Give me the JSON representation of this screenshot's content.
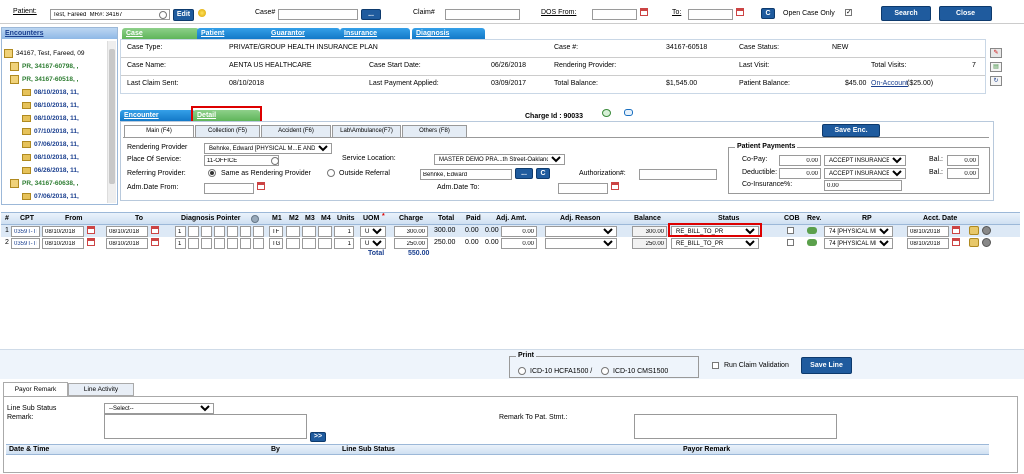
{
  "topbar": {
    "patient_label": "Patient:",
    "patient_value": "Test, Fareed  MR#: 34167",
    "edit": "Edit",
    "case_label": "Case#",
    "ellipsis": "...",
    "claim_label": "Claim#",
    "dos_from_label": "DOS From:",
    "to_label": "To:",
    "c": "C",
    "open_case_only": "Open Case Only",
    "search": "Search",
    "close": "Close"
  },
  "sidebar": {
    "title": "Encounters",
    "items": [
      {
        "label": "34167, Test, Fareed, 09",
        "style": "plain"
      },
      {
        "label": "PR, 34167-60798, ,",
        "style": "green"
      },
      {
        "label": "PR, 34167-60518, ,",
        "style": "green"
      },
      {
        "label": "08/10/2018, 11,",
        "style": "enc"
      },
      {
        "label": "08/10/2018, 11,",
        "style": "enc"
      },
      {
        "label": "08/10/2018, 11,",
        "style": "enc"
      },
      {
        "label": "07/10/2018, 11,",
        "style": "enc"
      },
      {
        "label": "07/06/2018, 11,",
        "style": "enc"
      },
      {
        "label": "08/10/2018, 11,",
        "style": "enc"
      },
      {
        "label": "06/26/2018, 11,",
        "style": "enc"
      },
      {
        "label": "PR, 34167-60638, ,",
        "style": "green"
      },
      {
        "label": "07/06/2018, 11,",
        "style": "enc"
      }
    ]
  },
  "casetabs": {
    "case": "Case",
    "patient": "Patient",
    "guarantor": "Guarantor",
    "insurance": "Insurance",
    "diagnosis": "Diagnosis"
  },
  "caseinfo": {
    "case_type_label": "Case Type:",
    "case_type": "PRIVATE/GROUP HEALTH INSURANCE PLAN",
    "case_no_label": "Case #:",
    "case_no": "34167-60518",
    "case_status_label": "Case Status:",
    "case_status": "NEW",
    "case_name_label": "Case Name:",
    "case_name": "AENTA US HEALTHCARE",
    "start_label": "Case Start Date:",
    "start": "06/26/2018",
    "rendering_label": "Rendering Provider:",
    "last_visit_label": "Last Visit:",
    "total_visits_label": "Total Visits:",
    "total_visits": "7",
    "last_claim_label": "Last Claim Sent:",
    "last_claim": "08/10/2018",
    "last_pay_label": "Last Payment Applied:",
    "last_pay": "03/09/2017",
    "total_bal_label": "Total Balance:",
    "total_bal": "$1,545.00",
    "pat_bal_label": "Patient Balance:",
    "pat_bal": "$45.00",
    "on_account": "On-Account",
    "on_account_amt": "($25.00)"
  },
  "enc": {
    "encounter_tab": "Encounter",
    "detail_tab": "Detail",
    "charge_id": "Charge Id : 90033",
    "subtabs": [
      "Main (F4)",
      "Collection (F5)",
      "Accident (F6)",
      "Lab\\Ambulance(F7)",
      "Others (F8)"
    ],
    "save_enc": "Save Enc.",
    "rendering_label": "Rendering Provider",
    "rendering_val": "Behnke, Edward [PHYSICAL M...E AND REHABILI",
    "pos_label": "Place Of Service:",
    "pos_val": "11-OFFICE",
    "service_loc_label": "Service Location:",
    "service_loc_val": "MASTER DEMO PRA...th Street-Oakland",
    "ref_label": "Referring Provider:",
    "same_as": "Same as Rendering Provider",
    "outside": "Outside Referral",
    "ref_val": "Behnke, Edward",
    "auth_label": "Authorization#:",
    "adm_from_label": "Adm.Date From:",
    "adm_to_label": "Adm.Date To:",
    "payments_title": "Patient Payments",
    "copay_label": "Co-Pay:",
    "copay": "0.00",
    "copay_sel": "ACCEPT INSURANCE",
    "ded_label": "Deductible:",
    "ded": "0.00",
    "ded_sel": "ACCEPT INSURANCE",
    "bal_label": "Bal.:",
    "bal1": "0.00",
    "bal2": "0.00",
    "coins_label": "Co-Insurance%:",
    "coins": "0.00"
  },
  "grid": {
    "headers": [
      "#",
      "CPT",
      "From",
      "To",
      "Diagnosis Pointer",
      "M1",
      "M2",
      "M3",
      "M4",
      "Units",
      "UOM",
      "Charge",
      "Total",
      "Paid",
      "Adj. Amt.",
      "Adj. Reason",
      "Balance",
      "Status",
      "COB",
      "Rev.",
      "RP",
      "Acct. Date"
    ],
    "rows": [
      {
        "n": "1",
        "cpt": "0359T-TI",
        "from": "08/10/2018",
        "to": "08/10/2018",
        "dx": "1",
        "m1": "TF",
        "units": "1",
        "uom": "UN",
        "charge": "300.00",
        "total": "300.00",
        "paid": "0.00",
        "adj": "0.00",
        "adjamt": "0.00",
        "bal": "300.00",
        "status": "RE_BILL_TO_PR",
        "rp": "74 [PHYSICAL MEC",
        "acct": "08/10/2018"
      },
      {
        "n": "2",
        "cpt": "0359T-TI",
        "from": "08/10/2018",
        "to": "08/10/2018",
        "dx": "1",
        "m1": "TG",
        "units": "1",
        "uom": "UN",
        "charge": "250.00",
        "total": "250.00",
        "paid": "0.00",
        "adj": "0.00",
        "adjamt": "0.00",
        "bal": "250.00",
        "status": "RE_BILL_TO_PR",
        "rp": "74 [PHYSICAL MEC",
        "acct": "08/10/2018"
      }
    ],
    "total_label": "Total",
    "total": "550.00"
  },
  "print": {
    "title": "Print",
    "opt1": "ICD-10 HCFA1500 /",
    "opt2": "ICD-10 CMS1500",
    "run_claim": "Run Claim Validation",
    "save_line": "Save Line"
  },
  "remark": {
    "tabs": [
      "Payor Remark",
      "Line Activity"
    ],
    "line_sub_label": "Line Sub Status",
    "select": "--Select--",
    "remark_label": "Remark:",
    "remark_pat": "Remark To Pat. Stmt.:",
    "go": ">>",
    "cols": [
      "Date & Time",
      "By",
      "Line Sub Status",
      "Payor Remark"
    ]
  }
}
